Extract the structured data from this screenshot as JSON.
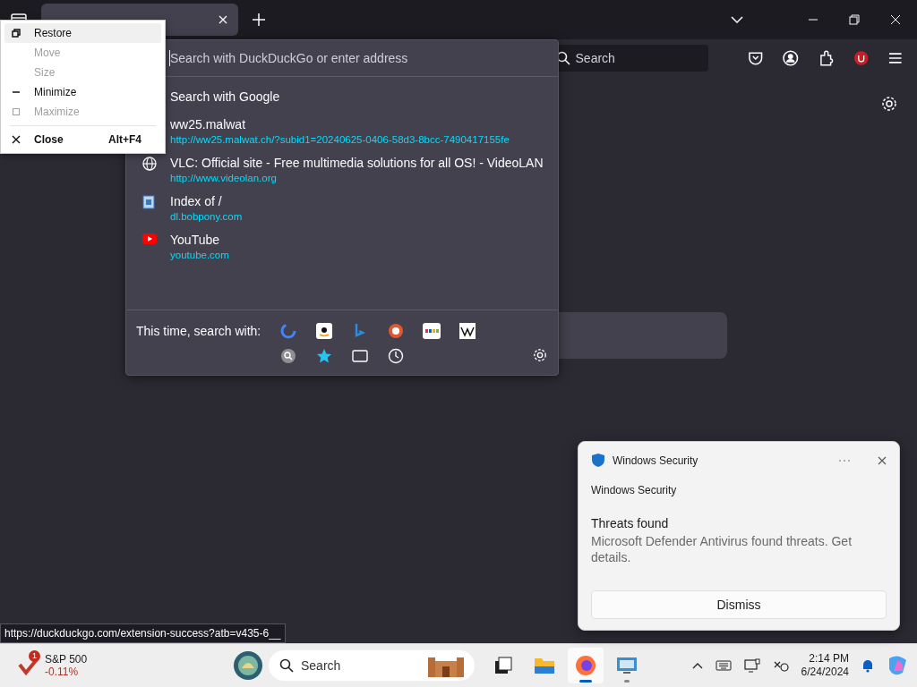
{
  "tab_strip": {
    "tabs": [
      {
        "selected": true
      }
    ]
  },
  "toolbar": {
    "address_placeholder": "Search with DuckDuckGo or enter address",
    "search_placeholder": "Search"
  },
  "system_menu": {
    "items": [
      {
        "kind": "restore",
        "label": "Restore",
        "disabled": false,
        "selected": true
      },
      {
        "kind": "move",
        "label": "Move",
        "disabled": true,
        "selected": false
      },
      {
        "kind": "size",
        "label": "Size",
        "disabled": true,
        "selected": false
      },
      {
        "kind": "minimize",
        "label": "Minimize",
        "disabled": false,
        "selected": false
      },
      {
        "kind": "maximize",
        "label": "Maximize",
        "disabled": true,
        "selected": false
      },
      {
        "kind": "separator"
      },
      {
        "kind": "close",
        "label": "Close",
        "shortcut": "Alt+F4",
        "disabled": false,
        "selected": false
      }
    ]
  },
  "dropdown": {
    "suggestion": "Search with Google",
    "results": [
      {
        "kind": "plain",
        "title": "ww25.malwat",
        "url": "http://ww25.malwat.ch/?subid1=20240625-0406-58d3-8bcc-7490417155fe"
      },
      {
        "kind": "site",
        "title": "VLC: Official site - Free multimedia solutions for all OS! - VideoLAN",
        "url": "http://www.videolan.org"
      },
      {
        "kind": "directory",
        "title": "Index of /",
        "url": "dl.bobpony.com"
      },
      {
        "kind": "video",
        "title": "YouTube",
        "url": "youtube.com"
      }
    ],
    "one_off_label": "This time, search with:"
  },
  "notification": {
    "app": "Windows Security",
    "header": "Windows Security",
    "title": "Threats found",
    "body": "Microsoft Defender Antivirus found threats. Get details.",
    "button": "Dismiss"
  },
  "status_url": "https://duckduckgo.com/extension-success?atb=v435-6__",
  "taskbar": {
    "widget": {
      "badge": "1",
      "name": "S&P 500",
      "change": "-0.11%"
    },
    "search_placeholder": "Search",
    "apps": [
      {
        "kind": "taskview",
        "selected": false,
        "running": false
      },
      {
        "kind": "explorer",
        "selected": false,
        "running": false
      },
      {
        "kind": "firefox",
        "selected": true,
        "running": true
      },
      {
        "kind": "monitor",
        "selected": false,
        "running": true
      }
    ],
    "time": "2:14 PM",
    "date": "6/24/2024"
  }
}
